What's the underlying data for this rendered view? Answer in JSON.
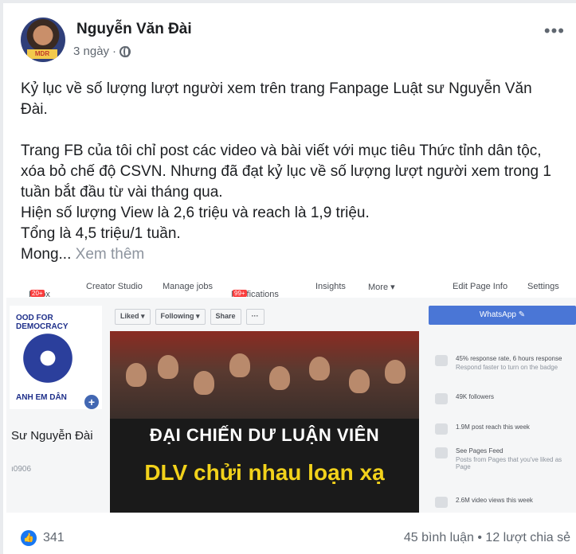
{
  "post": {
    "author": "Nguyễn Văn Đài",
    "time": "3 ngày",
    "separator": "·",
    "more": "•••",
    "paragraphs": [
      "Kỷ lục về số lượng lượt người xem trên trang Fanpage Luật sư Nguyễn Văn Đài.",
      "Trang FB của tôi chỉ post các video và bài viết với mục tiêu Thức tỉnh dân tộc, xóa bỏ chế độ CSVN. Nhưng đã đạt kỷ lục về số lượng lượt người xem trong 1 tuần bắt đầu từ vài tháng qua.",
      "Hiện số lượng View là 2,6 triệu và reach là 1,9 triệu.",
      "Tổng là 4,5 triệu/1 tuần.",
      "Mong..."
    ],
    "see_more": "Xem thêm"
  },
  "embedded": {
    "nav": {
      "inbox": "Inbox",
      "inbox_badge": "20+",
      "creator_studio": "Creator Studio",
      "manage_jobs": "Manage jobs",
      "notifications": "Notifications",
      "notifications_badge": "99+",
      "insights": "Insights",
      "more": "More ▾",
      "edit_page_info": "Edit Page Info",
      "settings": "Settings"
    },
    "logo_top": "OOD FOR DEMOCRACY",
    "logo_bottom": "ANH EM DÂN",
    "page_name": "Sư Nguyễn Đài",
    "page_id": "ı0906",
    "actions": [
      "Liked ▾",
      "Following ▾",
      "Share",
      "···"
    ],
    "cover_line1": "ĐẠI CHIẾN DƯ LUẬN VIÊN",
    "cover_line2": "DLV chửi nhau loạn xạ",
    "whatsapp": "WhatsApp ✎",
    "stats": [
      {
        "text": "45% response rate, 6 hours response",
        "sub": "Respond faster to turn on the badge"
      },
      {
        "text": "49K followers",
        "sub": ""
      },
      {
        "text": "1.9M post reach this week",
        "sub": ""
      },
      {
        "text": "See Pages Feed",
        "sub": "Posts from Pages that you've liked as Page"
      },
      {
        "text": "2.6M video views this week",
        "sub": ""
      }
    ]
  },
  "footer": {
    "likes": "341",
    "comments_shares": "45 bình luận • 12 lượt chia sẻ"
  },
  "colors": {
    "accent": "#1877f2",
    "cover_yellow": "#f2d21b",
    "whatsapp_blue": "#4a76d6"
  }
}
